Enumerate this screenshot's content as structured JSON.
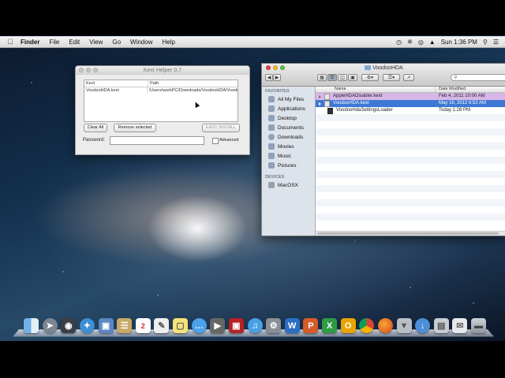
{
  "menubar": {
    "items": [
      "Finder",
      "File",
      "Edit",
      "View",
      "Go",
      "Window",
      "Help"
    ],
    "clock": "Sun 1:36 PM"
  },
  "kext_helper": {
    "title": "Kext Helper 0.7",
    "columns": [
      "Kext",
      "Path"
    ],
    "rows": [
      {
        "kext": "VoodooHDA.kext",
        "path": "/Users/workPC/Downloads/VoodooHDA/VoodooHD"
      }
    ],
    "buttons": {
      "clear_all": "Clear All",
      "remove_selected": "Remove selected",
      "easy_install": "EASY INSTALL"
    },
    "password_label": "Password:",
    "advanced_label": "Advanced"
  },
  "finder": {
    "title": "VoodooHDA",
    "columns": {
      "name": "Name",
      "date": "Date Modified"
    },
    "sidebar": {
      "favorites_header": "FAVORITES",
      "favorites": [
        "All My Files",
        "Applications",
        "Desktop",
        "Documents",
        "Downloads",
        "Movies",
        "Music",
        "Pictures"
      ],
      "devices_header": "DEVICES",
      "devices": [
        "MacOSX"
      ]
    },
    "files": [
      {
        "name": "AppleHDADisabler.kext",
        "date": "Feb 4, 2011 10:00 AM",
        "tag": "purple"
      },
      {
        "name": "VoodooHDA.kext",
        "date": "May 16, 2012 6:52 AM",
        "tag": "selected"
      },
      {
        "name": "VoodooHdaSettingsLoader",
        "date": "Today 1:28 PM",
        "tag": "none"
      }
    ]
  },
  "dock": {
    "icons": [
      "finder-icon",
      "launchpad-icon",
      "dashboard-icon",
      "safari-icon",
      "preview-icon",
      "notes-icon",
      "calendar-icon",
      "textedit-icon",
      "stickies-icon",
      "messages-icon",
      "facetime-icon",
      "photobooth-icon",
      "itunes-icon",
      "system-preferences-icon",
      "word-icon",
      "powerpoint-icon",
      "excel-icon",
      "outlook-icon",
      "chrome-icon",
      "firefox-icon",
      "installer-icon",
      "downloads-stack-icon",
      "documents-stack-icon",
      "mail-stack-icon",
      "trash-icon"
    ]
  },
  "colors": {
    "selection": "#3d78d4",
    "purple_label": "#d7b6e8",
    "sidebar": "#dde3ea"
  }
}
